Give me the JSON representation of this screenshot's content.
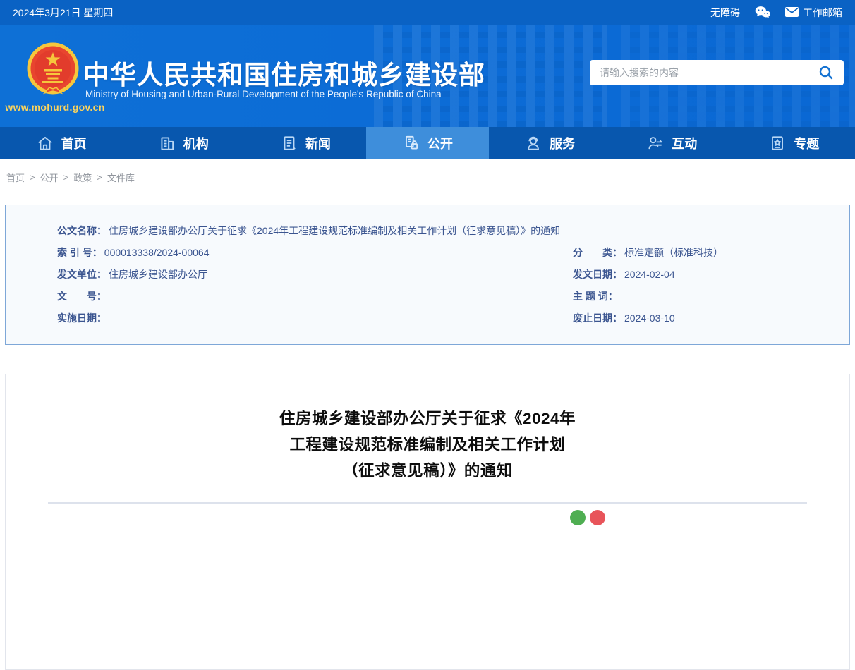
{
  "topbar": {
    "date": "2024年3月21日 星期四",
    "accessibility_label": "无障碍",
    "mailbox_label": "工作邮箱",
    "icons": [
      "wechat-icon",
      "mail-icon"
    ]
  },
  "header": {
    "site_name": "中华人民共和国住房和城乡建设部",
    "site_name_en": "Ministry of Housing and Urban-Rural Development of the People's Republic of China",
    "site_url": "www.mohurd.gov.cn",
    "search": {
      "placeholder": "请输入搜索的内容",
      "icon": "search-icon"
    }
  },
  "nav": {
    "items": [
      {
        "label": "首页",
        "icon": "home-icon",
        "active": false
      },
      {
        "label": "机构",
        "icon": "organization-icon",
        "active": false
      },
      {
        "label": "新闻",
        "icon": "news-icon",
        "active": false
      },
      {
        "label": "公开",
        "icon": "disclosure-icon",
        "active": true
      },
      {
        "label": "服务",
        "icon": "service-icon",
        "active": false
      },
      {
        "label": "互动",
        "icon": "interaction-icon",
        "active": false
      },
      {
        "label": "专题",
        "icon": "topics-icon",
        "active": false
      }
    ]
  },
  "breadcrumb": {
    "separator": ">",
    "items": [
      "首页",
      "公开",
      "政策",
      "文件库"
    ]
  },
  "metadata": {
    "doc_name": {
      "label": "公文名称：",
      "value": "住房城乡建设部办公厅关于征求《2024年工程建设规范标准编制及相关工作计划（征求意见稿）》的通知"
    },
    "rows": [
      {
        "left_label": "索 引 号：",
        "left_value": "000013338/2024-00064",
        "right_label": "分　　类：",
        "right_value": "标准定额（标准科技）"
      },
      {
        "left_label": "发文单位：",
        "left_value": "住房城乡建设部办公厅",
        "right_label": "发文日期：",
        "right_value": "2024-02-04"
      },
      {
        "left_label": "文　　号：",
        "left_value": "",
        "right_label": "主 题 词：",
        "right_value": ""
      },
      {
        "left_label": "实施日期：",
        "left_value": "",
        "right_label": "废止日期：",
        "right_value": "2024-03-10"
      }
    ]
  },
  "article": {
    "title_lines": [
      "住房城乡建设部办公厅关于征求《2024年",
      "工程建设规范标准编制及相关工作计划",
      "（征求意见稿）》的通知"
    ],
    "share_icons": [
      "wechat-share-icon",
      "weibo-share-icon"
    ]
  },
  "colors": {
    "topbar_bg": "#0a62c4",
    "header_bg": "#0d6ed6",
    "nav_bg": "#0857ae",
    "nav_active_bg": "#3e8edb",
    "meta_border": "#7ea7d8",
    "meta_bg": "#f7fafd",
    "meta_text": "#3b5590",
    "accent_gold": "#fcd45c",
    "share_green": "#4fae52",
    "share_red": "#e8545a"
  }
}
